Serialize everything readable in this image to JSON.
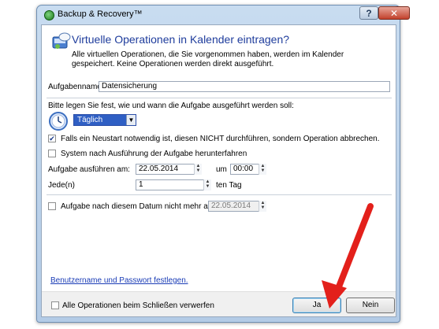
{
  "window": {
    "title": "Backup & Recovery™",
    "help_label": "?",
    "close_label": "✕"
  },
  "dialog": {
    "heading": "Virtuelle Operationen in Kalender eintragen?",
    "description": "Alle virtuellen Operationen, die Sie vorgenommen haben, werden im Kalender gespeichert. Keine Operationen werden direkt ausgeführt.",
    "task_name_label": "Aufgabenname:",
    "task_name_value": "Datensicherung",
    "schedule_prompt": "Bitte legen Sie fest, wie und wann die Aufgabe ausgeführt werden soll:",
    "frequency_value": "Täglich",
    "restart_option": {
      "label": "Falls ein Neustart notwendig ist, diesen NICHT durchführen, sondern Operation abbrechen.",
      "checked": true
    },
    "shutdown_option": {
      "label": "System nach Ausführung der Aufgabe herunterfahren",
      "checked": false
    },
    "run_on_label": "Aufgabe ausführen am:",
    "run_date": "22.05.2014",
    "at_label": "um",
    "run_time": "00:00",
    "every_label": "Jede(n)",
    "every_value": "1",
    "every_unit": "ten Tag",
    "end_date_option": {
      "label": "Aufgabe nach diesem Datum nicht mehr ausführen:",
      "checked": false
    },
    "end_date": "22.05.2014",
    "credentials_link": "Benutzername und Passwort festlegen.",
    "discard_option": {
      "label": "Alle Operationen beim Schließen verwerfen",
      "checked": false
    },
    "yes_button": "Ja",
    "no_button": "Nein"
  },
  "colors": {
    "heading": "#1e3c9c",
    "link": "#1a3cb6",
    "annotation_arrow": "#e3201b"
  }
}
